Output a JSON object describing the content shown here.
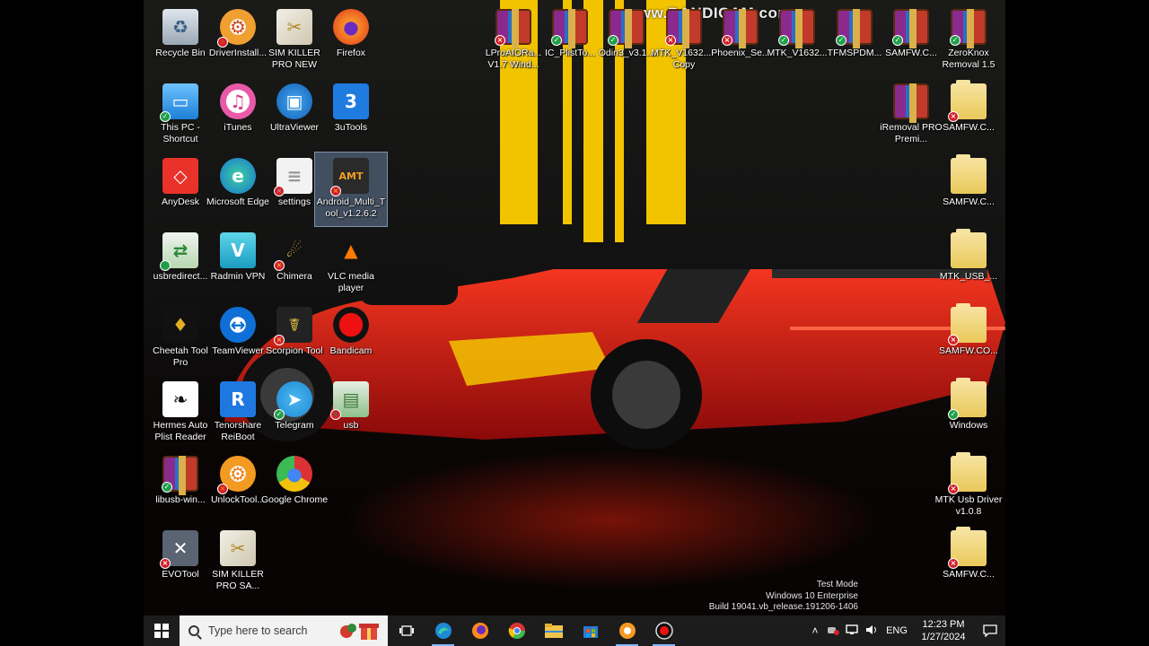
{
  "watermark": "www.BANDICAM.com",
  "desktop_icons": [
    {
      "id": "recycle-bin",
      "label": "Recycle Bin",
      "icon": "recycle-bin-icon",
      "badge": ""
    },
    {
      "id": "driverinstall",
      "label": "DriverInstall...",
      "icon": "driver-install-icon",
      "badge": "x"
    },
    {
      "id": "sim-killer-pro-new",
      "label": "SIM KILLER PRO NEW",
      "icon": "sim-killer-icon",
      "badge": ""
    },
    {
      "id": "firefox",
      "label": "Firefox",
      "icon": "firefox-icon",
      "badge": ""
    },
    {
      "id": "this-pc",
      "label": "This PC - Shortcut",
      "icon": "computer-icon",
      "badge": "ok"
    },
    {
      "id": "itunes",
      "label": "iTunes",
      "icon": "itunes-icon",
      "badge": ""
    },
    {
      "id": "ultraviewer",
      "label": "UltraViewer",
      "icon": "ultraviewer-icon",
      "badge": ""
    },
    {
      "id": "3utools",
      "label": "3uTools",
      "icon": "3utools-icon",
      "badge": ""
    },
    {
      "id": "anydesk",
      "label": "AnyDesk",
      "icon": "anydesk-icon",
      "badge": ""
    },
    {
      "id": "edge",
      "label": "Microsoft Edge",
      "icon": "edge-icon",
      "badge": ""
    },
    {
      "id": "settings",
      "label": "settings",
      "icon": "document-icon",
      "badge": "x"
    },
    {
      "id": "android-multi-tool",
      "label": "Android_Multi_Tool_v1.2.6.2",
      "icon": "android-multi-tool-icon",
      "badge": "x"
    },
    {
      "id": "usbredirect",
      "label": "usbredirect...",
      "icon": "usb-redirector-icon",
      "badge": "ok"
    },
    {
      "id": "radmin-vpn",
      "label": "Radmin VPN",
      "icon": "radmin-vpn-icon",
      "badge": ""
    },
    {
      "id": "chimera",
      "label": "Chimera",
      "icon": "chimera-icon",
      "badge": "x"
    },
    {
      "id": "vlc",
      "label": "VLC media player",
      "icon": "vlc-icon",
      "badge": ""
    },
    {
      "id": "cheetah-tool",
      "label": "Cheetah Tool Pro",
      "icon": "cheetah-tool-icon",
      "badge": ""
    },
    {
      "id": "teamviewer",
      "label": "TeamViewer",
      "icon": "teamviewer-icon",
      "badge": ""
    },
    {
      "id": "scorpion-tool",
      "label": "Scorpion Tool",
      "icon": "scorpion-tool-icon",
      "badge": "x"
    },
    {
      "id": "bandicam",
      "label": "Bandicam",
      "icon": "bandicam-icon",
      "badge": ""
    },
    {
      "id": "hermes-auto",
      "label": "Hermes Auto Plist Reader",
      "icon": "hermes-icon",
      "badge": ""
    },
    {
      "id": "reiboot",
      "label": "Tenorshare ReiBoot",
      "icon": "reiboot-icon",
      "badge": ""
    },
    {
      "id": "telegram",
      "label": "Telegram",
      "icon": "telegram-icon",
      "badge": "ok"
    },
    {
      "id": "usb",
      "label": "usb",
      "icon": "usb-archive-icon",
      "badge": "x"
    },
    {
      "id": "libusb-win",
      "label": "libusb-win...",
      "icon": "winrar-icon",
      "badge": "ok"
    },
    {
      "id": "unlocktool",
      "label": "UnlockTool...",
      "icon": "unlocktool-icon",
      "badge": "x"
    },
    {
      "id": "chrome",
      "label": "Google Chrome",
      "icon": "chrome-icon",
      "badge": ""
    },
    {
      "id": "evotool",
      "label": "EVOTool",
      "icon": "evotool-icon",
      "badge": "x"
    },
    {
      "id": "sim-killer-pro-sa",
      "label": "SIM KILLER PRO SA...",
      "icon": "sim-killer-icon",
      "badge": ""
    },
    {
      "id": "lpro-aio",
      "label": "LProAIORa... V1.7 Wind...",
      "icon": "winrar-icon",
      "badge": "x"
    },
    {
      "id": "ic-plist",
      "label": "IC_PlistTo...",
      "icon": "winrar-icon",
      "badge": "ok"
    },
    {
      "id": "odin3",
      "label": "Odin3_v3.1...",
      "icon": "winrar-icon",
      "badge": "ok"
    },
    {
      "id": "mtk-v1632-copy",
      "label": "MTK_V1632... - Copy",
      "icon": "winrar-icon",
      "badge": "x"
    },
    {
      "id": "phoenix",
      "label": "Phoenix_Se...",
      "icon": "winrar-icon",
      "badge": "x"
    },
    {
      "id": "mtk-v1632",
      "label": "MTK_V1632...",
      "icon": "winrar-icon",
      "badge": "ok"
    },
    {
      "id": "tfmspdm",
      "label": "TFMSPDM...",
      "icon": "winrar-icon",
      "badge": "ok"
    },
    {
      "id": "samfw-zip",
      "label": "SAMFW.C...",
      "icon": "winrar-icon",
      "badge": "ok"
    },
    {
      "id": "zeroknox",
      "label": "ZeroKnox Removal 1.5",
      "icon": "winrar-icon",
      "badge": "ok"
    },
    {
      "id": "iremoval",
      "label": "iRemoval PRO Premi...",
      "icon": "winrar-icon",
      "badge": ""
    },
    {
      "id": "samfw-1",
      "label": "SAMFW.C...",
      "icon": "folder-icon",
      "badge": "x"
    },
    {
      "id": "samfw-2",
      "label": "SAMFW.C...",
      "icon": "folder-icon",
      "badge": ""
    },
    {
      "id": "mtk-usb",
      "label": "MTK_USB_...",
      "icon": "folder-icon",
      "badge": ""
    },
    {
      "id": "samfw-co",
      "label": "SAMFW.CO...",
      "icon": "folder-icon",
      "badge": "x"
    },
    {
      "id": "windows",
      "label": "Windows",
      "icon": "folder-icon",
      "badge": "ok"
    },
    {
      "id": "mtk-usb-driver",
      "label": "MTK Usb Driver v1.0.8",
      "icon": "folder-icon",
      "badge": "x"
    },
    {
      "id": "samfw-3",
      "label": "SAMFW.C...",
      "icon": "folder-icon",
      "badge": "x"
    }
  ],
  "test_mode": {
    "line1": "Test Mode",
    "line2": "Windows 10 Enterprise",
    "line3": "Build 19041.vb_release.191206-1406"
  },
  "taskbar": {
    "search_placeholder": "Type here to search",
    "apps": [
      "task-view-icon",
      "edge-icon",
      "firefox-icon",
      "chrome-icon",
      "file-explorer-icon",
      "store-icon",
      "unlocktool-icon",
      "bandicam-icon"
    ],
    "language": "ENG",
    "time": "12:23 PM",
    "date": "1/27/2024"
  },
  "colors": {
    "taskbar": "#1c1c1c",
    "stripe": "#f2c400",
    "car": "#d3141a"
  }
}
